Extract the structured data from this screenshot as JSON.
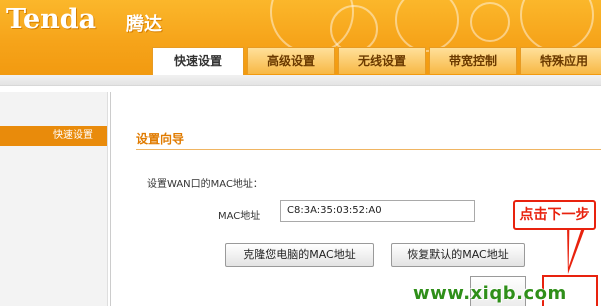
{
  "brand": {
    "logo": "Tenda",
    "logo_cn": "腾达"
  },
  "tabs": [
    "快速设置",
    "高级设置",
    "无线设置",
    "带宽控制",
    "特殊应用"
  ],
  "sidebar": {
    "items": [
      "快速设置"
    ]
  },
  "section": {
    "title": "设置向导"
  },
  "form": {
    "mac_desc": "设置WAN口的MAC地址：",
    "mac_label": "MAC地址",
    "mac_value": "C8:3A:35:03:52:A0"
  },
  "buttons": {
    "clone_mac": "克隆您电脑的MAC地址",
    "restore_mac": "恢复默认的MAC地址"
  },
  "callout": {
    "text": "点击下一步"
  },
  "watermark": {
    "text": "www.xiqb.com"
  },
  "colors": {
    "header": "#f6a41a",
    "accent": "#e98b0b",
    "annotation": "#e8220e",
    "watermark": "#2f8f19"
  }
}
